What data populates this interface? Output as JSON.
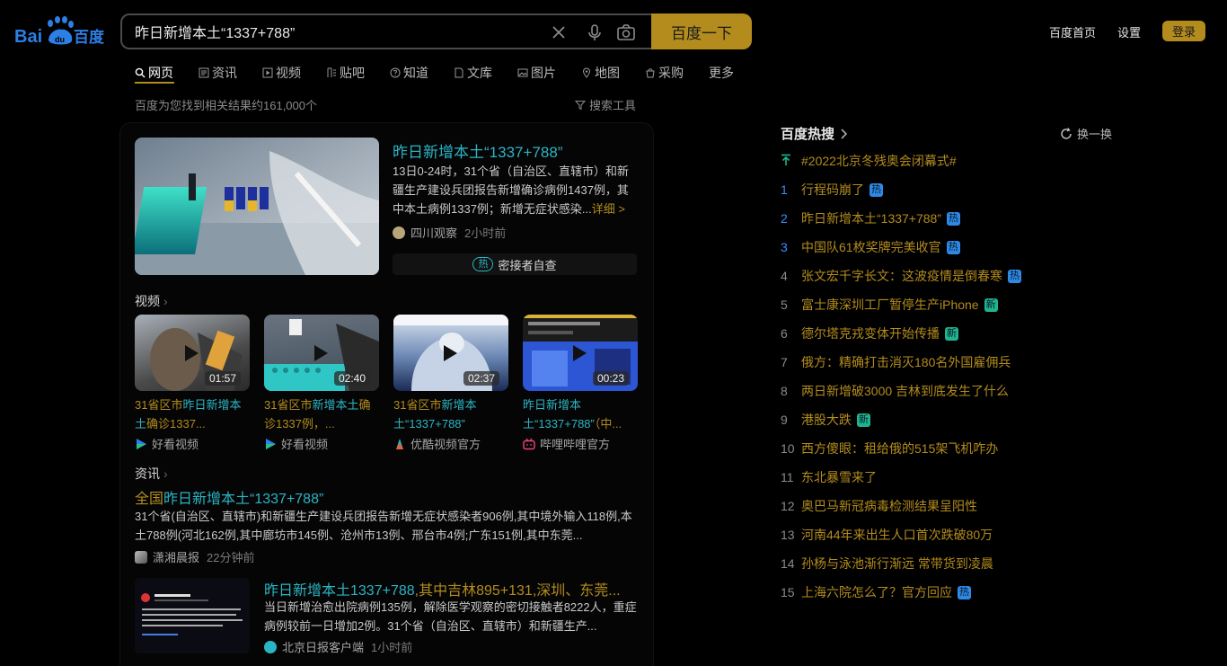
{
  "header": {
    "logo_text": "Bai百度",
    "search_value": "昨日新增本土“1337+788”",
    "search_button": "百度一下",
    "top_links": [
      "百度首页",
      "设置"
    ],
    "login": "登录"
  },
  "tabs": [
    {
      "label": "网页",
      "icon": "search-icon"
    },
    {
      "label": "资讯",
      "icon": "news-icon"
    },
    {
      "label": "视频",
      "icon": "video-icon"
    },
    {
      "label": "贴吧",
      "icon": "tieba-icon"
    },
    {
      "label": "知道",
      "icon": "question-icon"
    },
    {
      "label": "文库",
      "icon": "document-icon"
    },
    {
      "label": "图片",
      "icon": "image-icon"
    },
    {
      "label": "地图",
      "icon": "map-icon"
    },
    {
      "label": "采购",
      "icon": "shopping-icon"
    },
    {
      "label": "更多",
      "icon": ""
    }
  ],
  "result_count": "百度为您找到相关结果约161,000个",
  "search_tools": "搜索工具",
  "top_result": {
    "title": "昨日新增本土“1337+788”",
    "abstract": "13日0-24时，31个省（自治区、直辖市）和新疆生产建设兵团报告新增确诊病例1437例，其中本土病例1337例；新增无症状感染...",
    "more": "详细 >",
    "source": "四川观察",
    "time": "2小时前",
    "hot_badge": "热",
    "hot_query": "密接者自查"
  },
  "videos_section": {
    "title": "视频",
    "items": [
      {
        "title_pre": "31省区市",
        "title_hl": "昨日新增本土",
        "title_post": "确诊1337...",
        "duration": "01:57",
        "source": "好看视频"
      },
      {
        "title_pre": "31省区市",
        "title_hl": "新增本土",
        "title_post": "确诊1337例，...",
        "duration": "02:40",
        "source": "好看视频"
      },
      {
        "title_pre": "31省区市",
        "title_hl": "新增本土“1337+788”",
        "title_post": "",
        "duration": "02:37",
        "source": "优酷视频官方"
      },
      {
        "title_pre": "",
        "title_hl": "昨日新增本土“1337+788”",
        "title_post": "（中...",
        "duration": "00:23",
        "source": "哔哩哔哩官方"
      }
    ]
  },
  "news_section": {
    "title": "资讯",
    "item1": {
      "title_pre": "全国",
      "title_hl": "昨日新增本土“1337+788”",
      "abstract": "31个省(自治区、直辖市)和新疆生产建设兵团报告新增无症状感染者906例,其中境外输入118例,本土788例(河北162例,其中廊坊市145例、沧州市13例、邢台市4例;广东151例,其中东莞...",
      "source": "潇湘晨报",
      "time": "22分钟前"
    },
    "item2": {
      "title_hl": "昨日新增本土1337+788",
      "title_post": ",其中吉林895+131,深圳、东莞...",
      "abstract": "当日新增治愈出院病例135例，解除医学观察的密切接触者8222人，重症病例较前一日增加2例。31个省（自治区、直辖市）和新疆生产...",
      "source": "北京日报客户端",
      "time": "1小时前"
    }
  },
  "hot_search": {
    "title": "百度热搜",
    "refresh": "换一换",
    "items": [
      {
        "rank": "",
        "text": "#2022北京冬残奥会闭幕式#",
        "badge": ""
      },
      {
        "rank": "1",
        "text": "行程码崩了",
        "badge": "热"
      },
      {
        "rank": "2",
        "text": "昨日新增本土“1337+788”",
        "badge": "热"
      },
      {
        "rank": "3",
        "text": "中国队61枚奖牌完美收官",
        "badge": "热"
      },
      {
        "rank": "4",
        "text": "张文宏千字长文：这波疫情是倒春寒",
        "badge": "热"
      },
      {
        "rank": "5",
        "text": "富士康深圳工厂暂停生产iPhone",
        "badge": "新"
      },
      {
        "rank": "6",
        "text": "德尔塔克戎变体开始传播",
        "badge": "新"
      },
      {
        "rank": "7",
        "text": "俄方：精确打击消灭180名外国雇佣兵",
        "badge": ""
      },
      {
        "rank": "8",
        "text": "两日新增破3000 吉林到底发生了什么",
        "badge": ""
      },
      {
        "rank": "9",
        "text": "港股大跌",
        "badge": "新"
      },
      {
        "rank": "10",
        "text": "西方傻眼：租给俄的515架飞机咋办",
        "badge": ""
      },
      {
        "rank": "11",
        "text": "东北暴雪来了",
        "badge": ""
      },
      {
        "rank": "12",
        "text": "奥巴马新冠病毒检测结果呈阳性",
        "badge": ""
      },
      {
        "rank": "13",
        "text": "河南44年来出生人口首次跌破80万",
        "badge": ""
      },
      {
        "rank": "14",
        "text": "孙杨与泳池渐行渐远 常带货到凌晨",
        "badge": ""
      },
      {
        "rank": "15",
        "text": "上海六院怎么了？官方回应",
        "badge": "热"
      }
    ]
  },
  "colors": {
    "accent_gold": "#b38c1d",
    "link_teal": "#2bb5c4",
    "hot_badge": "#2e8ae6",
    "new_badge": "#1fb48d"
  }
}
